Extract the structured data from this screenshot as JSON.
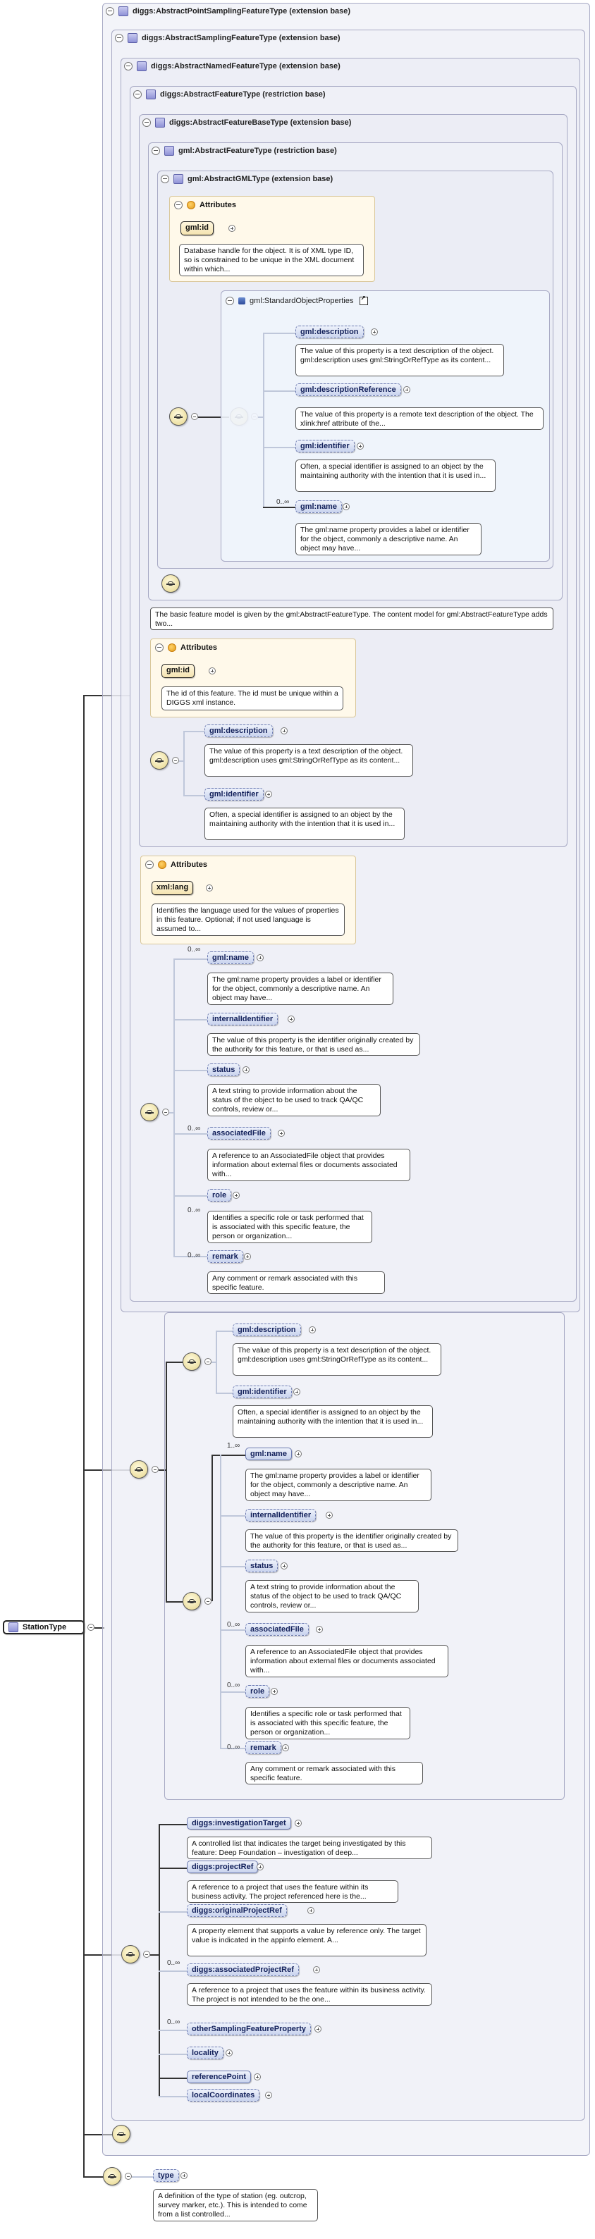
{
  "root": {
    "name": "StationType"
  },
  "boxes": {
    "b1": "diggs:AbstractPointSamplingFeatureType (extension base)",
    "b2": "diggs:AbstractSamplingFeatureType (extension base)",
    "b3": "diggs:AbstractNamedFeatureType (extension base)",
    "b4": "diggs:AbstractFeatureType (restriction base)",
    "b5": "diggs:AbstractFeatureBaseType (extension base)",
    "b6": "gml:AbstractFeatureType (restriction base)",
    "b7": "gml:AbstractGMLType (extension base)",
    "sop": "gml:StandardObjectProperties"
  },
  "attributes_label": "Attributes",
  "gml_attrs": {
    "id1": {
      "name": "gml:id",
      "desc": "Database handle for the object. It is of XML type ID, so is constrained to be unique in the XML document within which..."
    },
    "id2": {
      "name": "gml:id",
      "desc": "The id of this feature. The id must be unique within a DIGGS xml instance."
    },
    "lang": {
      "name": "xml:lang",
      "desc": "Identifies the language used for the values of properties in this feature. Optional; if not used language is assumed to..."
    }
  },
  "sop_items": [
    {
      "name": "gml:description",
      "desc": "The value of this property is a text description of the object. gml:description uses gml:StringOrRefType as its content..."
    },
    {
      "name": "gml:descriptionReference",
      "desc": "The value of this property is a remote text description of the object. The xlink:href attribute of the..."
    },
    {
      "name": "gml:identifier",
      "desc": "Often, a special identifier is assigned to an object by the maintaining authority with the intention that it is used in..."
    },
    {
      "name": "gml:name",
      "mult": "0..∞",
      "desc": "The gml:name property provides a label or identifier for the object, commonly a descriptive name. An object may have..."
    }
  ],
  "feature_model_note": "The basic feature model is given by the gml:AbstractFeatureType. The content model for gml:AbstractFeatureType adds two...",
  "b5_items": [
    {
      "name": "gml:description",
      "desc": "The value of this property is a text description of the object. gml:description uses gml:StringOrRefType as its content..."
    },
    {
      "name": "gml:identifier",
      "desc": "Often, a special identifier is assigned to an object by the maintaining authority with the intention that it is used in..."
    }
  ],
  "b3_items": [
    {
      "name": "gml:name",
      "mult": "0..∞",
      "desc": "The gml:name property provides a label or identifier for the object, commonly a descriptive name. An object may have..."
    },
    {
      "name": "internalIdentifier",
      "mult": "",
      "desc": "The value of this property is the identifier originally created by the authority for this feature, or that is used as..."
    },
    {
      "name": "status",
      "mult": "",
      "desc": "A text string to provide information about the status of the object to be used to track QA/QC controls, review or..."
    },
    {
      "name": "associatedFile",
      "mult": "0..∞",
      "desc": "A reference to an AssociatedFile object that provides information about external files or documents associated with..."
    },
    {
      "name": "role",
      "mult": "0..∞",
      "desc": "Identifies a specific role or task performed that is associated with this specific feature, the person or organization..."
    },
    {
      "name": "remark",
      "mult": "0..∞",
      "desc": "Any comment or remark associated with this specific feature."
    }
  ],
  "b2_top_items": [
    {
      "name": "gml:description",
      "desc": "The value of this property is a text description of the object. gml:description uses gml:StringOrRefType as its content..."
    },
    {
      "name": "gml:identifier",
      "desc": "Often, a special identifier is assigned to an object by the maintaining authority with the intention that it is used in..."
    }
  ],
  "b2_items": [
    {
      "name": "gml:name",
      "mult": "1..∞",
      "desc": "The gml:name property provides a label or identifier for the object, commonly a descriptive name. An object may have..."
    },
    {
      "name": "internalIdentifier",
      "mult": "",
      "desc": "The value of this property is the identifier originally created by the authority for this feature, or that is used as..."
    },
    {
      "name": "status",
      "mult": "",
      "desc": "A text string to provide information about the status of the object to be used to track QA/QC controls, review or..."
    },
    {
      "name": "associatedFile",
      "mult": "0..∞",
      "desc": "A reference to an AssociatedFile object that provides information about external files or documents associated with..."
    },
    {
      "name": "role",
      "mult": "0..∞",
      "desc": "Identifies a specific role or task performed that is associated with this specific feature, the person or organization..."
    },
    {
      "name": "remark",
      "mult": "0..∞",
      "desc": "Any comment or remark associated with this specific feature."
    }
  ],
  "sampling_items": [
    {
      "name": "diggs:investigationTarget",
      "mult": "",
      "desc": "A controlled list that indicates the target being investigated by this feature: Deep Foundation – investigation of deep..."
    },
    {
      "name": "diggs:projectRef",
      "mult": "",
      "desc": "A reference to a project that uses the feature within its business activity. The project referenced here is the..."
    },
    {
      "name": "diggs:originalProjectRef",
      "mult": "",
      "desc": "A property element that supports a value by reference only. The target value is indicated in the appinfo element. A..."
    },
    {
      "name": "diggs:associatedProjectRef",
      "mult": "0..∞",
      "desc": "A reference to a project that uses the feature within its business activity. The project is not intended to be the one..."
    },
    {
      "name": "otherSamplingFeatureProperty",
      "mult": "0..∞",
      "desc": ""
    },
    {
      "name": "locality",
      "mult": "",
      "desc": ""
    },
    {
      "name": "referencePoint",
      "mult": "",
      "desc": ""
    },
    {
      "name": "localCoordinates",
      "mult": "",
      "desc": ""
    }
  ],
  "type_item": {
    "name": "type",
    "desc": "A definition of the type of station (eg. outcrop, survey marker, etc.). This is intended to come from a list controlled..."
  }
}
